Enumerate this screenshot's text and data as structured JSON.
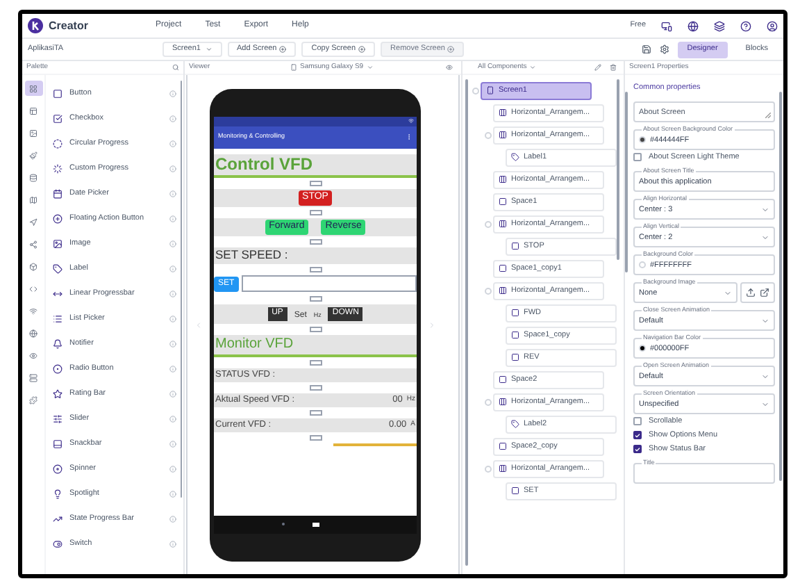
{
  "app": {
    "name": "Creator",
    "menu": [
      "Project",
      "Test",
      "Export",
      "Help"
    ],
    "plan": "Free"
  },
  "toolbar": {
    "project": "AplikasiTA",
    "screen": "Screen1",
    "actions": [
      {
        "label": "Add Screen",
        "disabled": false
      },
      {
        "label": "Copy Screen",
        "disabled": false
      },
      {
        "label": "Remove Screen",
        "disabled": true
      }
    ],
    "views": [
      {
        "label": "Designer",
        "selected": true
      },
      {
        "label": "Blocks",
        "selected": false
      }
    ]
  },
  "palette": {
    "title": "Palette",
    "categories": [
      {
        "selected": true
      },
      {
        "selected": false
      },
      {
        "selected": false
      },
      {
        "selected": false
      },
      {
        "selected": false
      },
      {
        "selected": false
      },
      {
        "selected": false
      },
      {
        "selected": false
      },
      {
        "selected": false
      },
      {
        "selected": false
      },
      {
        "selected": false
      },
      {
        "selected": false
      },
      {
        "selected": false
      },
      {
        "selected": false
      },
      {
        "selected": false
      }
    ],
    "items": [
      "Button",
      "Checkbox",
      "Circular Progress",
      "Custom Progress",
      "Date Picker",
      "Floating Action Button",
      "Image",
      "Label",
      "Linear Progressbar",
      "List Picker",
      "Notifier",
      "Radio Button",
      "Rating Bar",
      "Slider",
      "Snackbar",
      "Spinner",
      "Spotlight",
      "State Progress Bar",
      "Switch"
    ]
  },
  "viewer": {
    "title": "Viewer",
    "device": "Samsung Galaxy S9",
    "phone": {
      "app_title": "Monitoring & Controlling",
      "control_heading": "Control VFD",
      "stop": "STOP",
      "forward": "Forward",
      "reverse": "Reverse",
      "set_speed_label": "SET SPEED :",
      "set_button": "SET",
      "up": "UP",
      "set_text": "Set",
      "unit": "Hz",
      "down": "DOWN",
      "monitor_heading": "Monitor VFD",
      "readings": [
        {
          "label": "STATUS VFD :"
        },
        {
          "label": "Aktual Speed VFD :",
          "value": "00",
          "unit": "Hz"
        },
        {
          "label": "Current VFD :",
          "value": "0.00",
          "unit": "A"
        }
      ]
    }
  },
  "components": {
    "filter": "All Components",
    "tree": [
      {
        "label": "Screen1",
        "kind": "screen",
        "selected": true,
        "children": [
          {
            "label": "Horizontal_Arrangem...",
            "kind": "arrangement",
            "selected": false
          },
          {
            "label": "Horizontal_Arrangem...",
            "kind": "arrangement",
            "selected": false,
            "children": [
              {
                "label": "Label1",
                "kind": "label",
                "selected": false
              }
            ]
          },
          {
            "label": "Horizontal_Arrangem...",
            "kind": "arrangement",
            "selected": false
          },
          {
            "label": "Space1",
            "kind": "space",
            "selected": false
          },
          {
            "label": "Horizontal_Arrangem...",
            "kind": "arrangement",
            "selected": false,
            "children": [
              {
                "label": "STOP",
                "kind": "button",
                "selected": false
              }
            ]
          },
          {
            "label": "Space1_copy1",
            "kind": "space",
            "selected": false
          },
          {
            "label": "Horizontal_Arrangem...",
            "kind": "arrangement",
            "selected": false,
            "children": [
              {
                "label": "FWD",
                "kind": "button",
                "selected": false
              },
              {
                "label": "Space1_copy",
                "kind": "space",
                "selected": false
              },
              {
                "label": "REV",
                "kind": "button",
                "selected": false
              }
            ]
          },
          {
            "label": "Space2",
            "kind": "space",
            "selected": false
          },
          {
            "label": "Horizontal_Arrangem...",
            "kind": "arrangement",
            "selected": false,
            "children": [
              {
                "label": "Label2",
                "kind": "label",
                "selected": false
              }
            ]
          },
          {
            "label": "Space2_copy",
            "kind": "space",
            "selected": false
          },
          {
            "label": "Horizontal_Arrangem...",
            "kind": "arrangement",
            "selected": false,
            "children": [
              {
                "label": "SET",
                "kind": "button",
                "selected": false
              }
            ]
          }
        ]
      }
    ]
  },
  "properties": {
    "title": "Screen1 Properties",
    "section": "Common properties",
    "fields": [
      {
        "kind": "textarea",
        "placeholder": "About Screen"
      },
      {
        "kind": "color",
        "label": "About Screen Background Color",
        "value": "#444444FF",
        "color": "#444444"
      },
      {
        "kind": "checkbox",
        "label": "About Screen Light Theme",
        "checked": false
      },
      {
        "kind": "text",
        "label": "About Screen Title",
        "value": "About this application"
      },
      {
        "kind": "select",
        "label": "Align Horizontal",
        "value": "Center : 3"
      },
      {
        "kind": "select",
        "label": "Align Vertical",
        "value": "Center : 2"
      },
      {
        "kind": "color",
        "label": "Background Color",
        "value": "#FFFFFFFF",
        "color": "#ffffff"
      },
      {
        "kind": "image",
        "label": "Background Image",
        "value": "None"
      },
      {
        "kind": "select",
        "label": "Close Screen Animation",
        "value": "Default"
      },
      {
        "kind": "color",
        "label": "Navigation Bar Color",
        "value": "#000000FF",
        "color": "#000000"
      },
      {
        "kind": "select",
        "label": "Open Screen Animation",
        "value": "Default"
      },
      {
        "kind": "select",
        "label": "Screen Orientation",
        "value": "Unspecified"
      },
      {
        "kind": "checkbox",
        "label": "Scrollable",
        "checked": false
      },
      {
        "kind": "checkbox",
        "label": "Show Options Menu",
        "checked": true
      },
      {
        "kind": "checkbox",
        "label": "Show Status Bar",
        "checked": true
      },
      {
        "kind": "text",
        "label": "Title"
      }
    ]
  }
}
